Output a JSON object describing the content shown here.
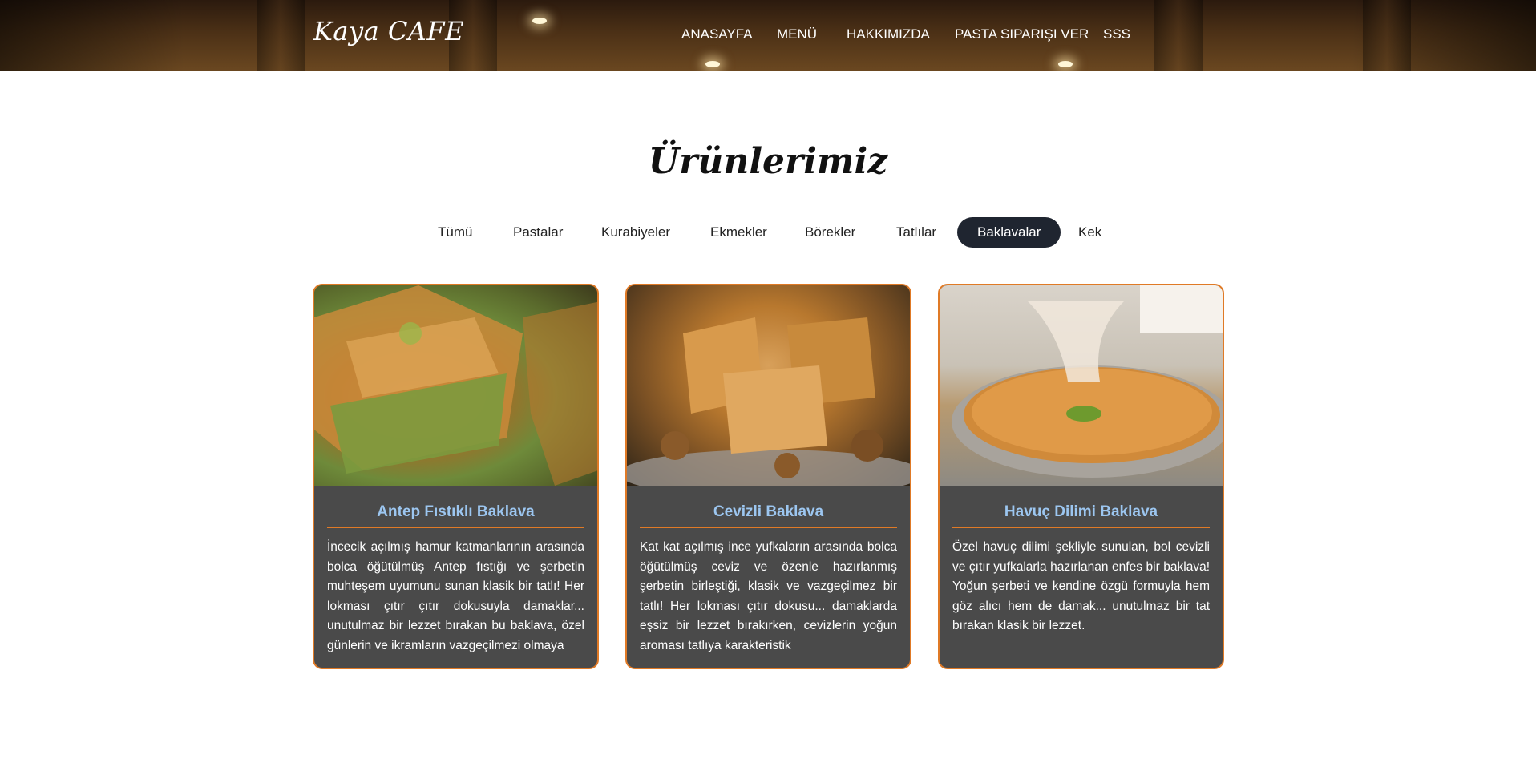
{
  "header": {
    "logo": "Kaya CAFE",
    "nav": [
      "ANASAYFA",
      "MENÜ",
      "HAKKIMIZDA",
      "PASTA SIPARIŞI VER",
      "SSS"
    ]
  },
  "main": {
    "title": "Ürünlerimiz",
    "filters": [
      "Tümü",
      "Pastalar",
      "Kurabiyeler",
      "Ekmekler",
      "Börekler",
      "Tatlılar",
      "Baklavalar",
      "Kek"
    ],
    "active_filter": "Baklavalar",
    "products": [
      {
        "name": "Antep Fıstıklı Baklava",
        "description": "İncecik açılmış hamur katmanlarının arasında bolca öğütülmüş Antep fıstığı ve şerbetin muhteşem uyumunu sunan klasik bir tatlı! Her lokması çıtır çıtır dokusuyla damaklar... unutulmaz bir lezzet bırakan bu baklava, özel günlerin ve ikramların vazgeçilmezi olmaya"
      },
      {
        "name": "Cevizli Baklava",
        "description": "Kat kat açılmış ince yufkaların arasında bolca öğütülmüş ceviz ve özenle hazırlanmış şerbetin birleştiği, klasik ve vazgeçilmez bir tatlı! Her lokması çıtır dokusu... damaklarda eşsiz bir lezzet bırakırken, cevizlerin yoğun aroması tatlıya karakteristik"
      },
      {
        "name": "Havuç Dilimi Baklava",
        "description": "Özel havuç dilimi şekliyle sunulan, bol cevizli ve çıtır yufkalarla hazırlanan enfes bir baklava! Yoğun şerbeti ve kendine özgü formuyla hem göz alıcı hem de damak... unutulmaz bir tat bırakan klasik bir lezzet."
      }
    ]
  },
  "colors": {
    "accent": "#e07a26",
    "card_bg": "#4a4a4a",
    "card_title": "#9cc6f0",
    "active_pill": "#1f2530"
  }
}
